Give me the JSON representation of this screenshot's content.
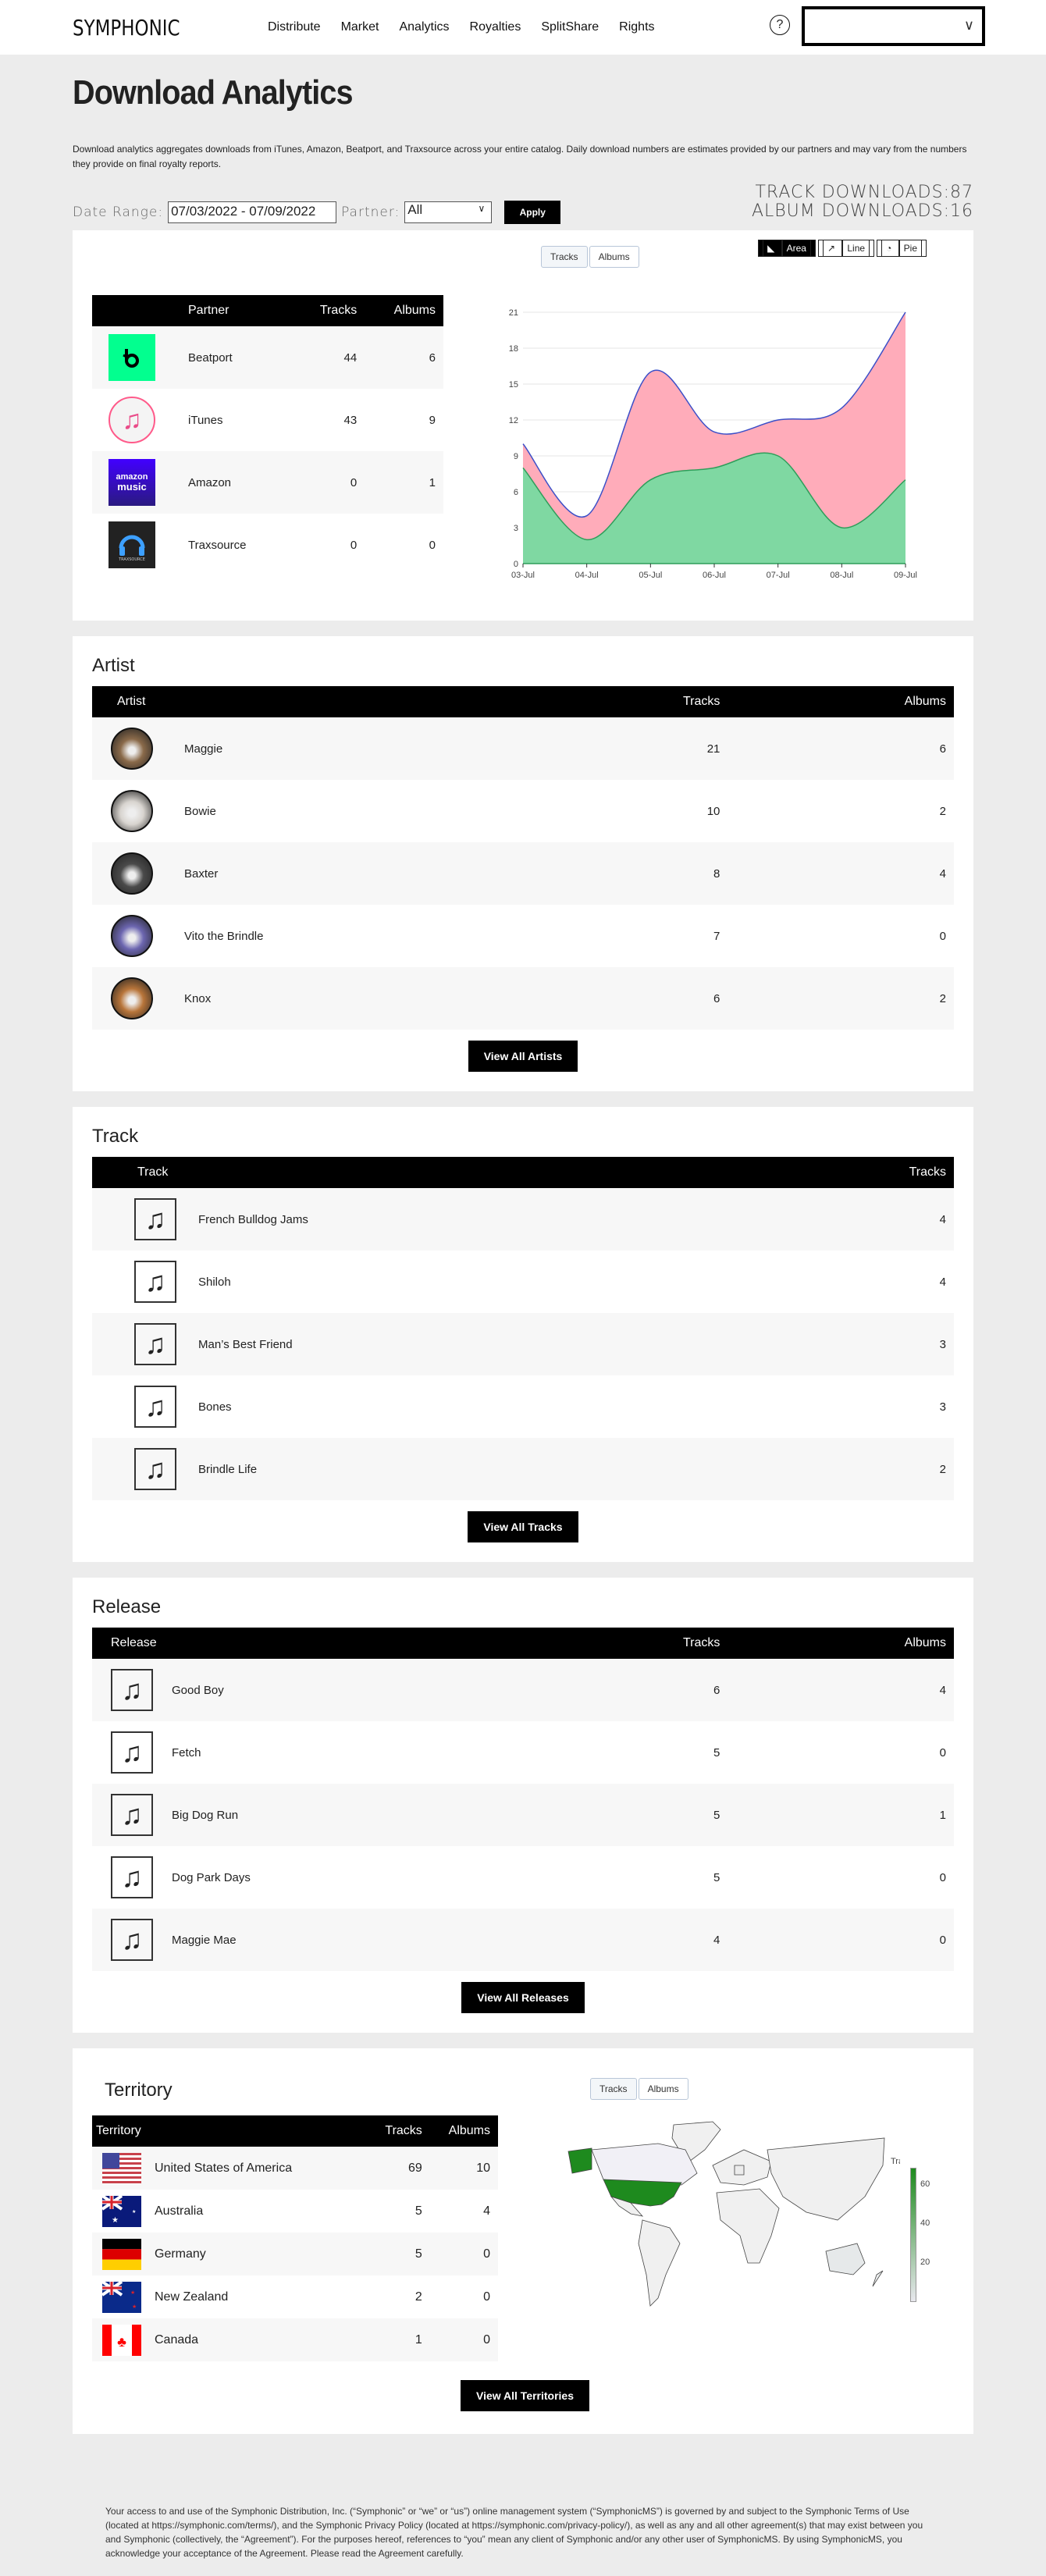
{
  "header": {
    "logo": "SYMPHONIC",
    "nav": [
      "Distribute",
      "Market",
      "Analytics",
      "Royalties",
      "SplitShare",
      "Rights"
    ],
    "help_icon": "?",
    "account_select_value": "",
    "chevron": "∨"
  },
  "page": {
    "title": "Download Analytics",
    "intro": "Download analytics aggregates downloads from iTunes, Amazon, Beatport, and Traxsource across your entire catalog. Daily download numbers are estimates provided by our partners and may vary from the numbers they provide on final royalty reports.",
    "date_range_label": "Date Range:",
    "date_range_value": "07/03/2022 - 07/09/2022",
    "partner_label": "Partner:",
    "partner_value": "All",
    "apply_label": "Apply",
    "track_downloads": "TRACK DOWNLOADS:87",
    "album_downloads": "ALBUM DOWNLOADS:16"
  },
  "partners": {
    "headers": [
      "",
      "Partner",
      "Tracks",
      "Albums"
    ],
    "rows": [
      {
        "name": "Beatport",
        "tracks": "44",
        "albums": "6",
        "icon": "beatport-logo"
      },
      {
        "name": "iTunes",
        "tracks": "43",
        "albums": "9",
        "icon": "itunes-logo"
      },
      {
        "name": "Amazon",
        "tracks": "0",
        "albums": "1",
        "icon": "amazon-music-logo"
      },
      {
        "name": "Traxsource",
        "tracks": "0",
        "albums": "0",
        "icon": "traxsource-logo"
      }
    ]
  },
  "chart_toggle": {
    "tracks": "Tracks",
    "albums": "Albums",
    "selected": "Tracks"
  },
  "chart_type": {
    "area": "Area",
    "line": "Line",
    "pie": "Pie",
    "selected": "Area"
  },
  "chart_data": {
    "type": "area",
    "stacked": true,
    "title": "",
    "xlabel": "",
    "ylabel": "",
    "categories": [
      "03-Jul",
      "04-Jul",
      "05-Jul",
      "06-Jul",
      "07-Jul",
      "08-Jul",
      "09-Jul"
    ],
    "series": [
      {
        "name": "Beatport",
        "color": "#7fd8a2",
        "line": "#2e9e5a",
        "values": [
          8,
          2,
          7,
          8,
          9,
          3,
          7
        ]
      },
      {
        "name": "iTunes",
        "color": "#ffacba",
        "line": "#3b4fc8",
        "values": [
          2,
          2,
          9,
          3,
          3,
          10,
          14
        ]
      }
    ],
    "yticks": [
      0,
      3,
      6,
      9,
      12,
      15,
      18,
      21
    ],
    "ylim": [
      0,
      21
    ],
    "grid": true
  },
  "artists": {
    "title": "Artist",
    "headers": [
      "Artist",
      "Tracks",
      "Albums"
    ],
    "rows": [
      {
        "name": "Maggie",
        "tracks": "21",
        "albums": "6",
        "color": "#8a6a4a"
      },
      {
        "name": "Bowie",
        "tracks": "10",
        "albums": "2",
        "color": "#d8d4cf"
      },
      {
        "name": "Baxter",
        "tracks": "8",
        "albums": "4",
        "color": "#4a4a4a"
      },
      {
        "name": "Vito the Brindle",
        "tracks": "7",
        "albums": "0",
        "color": "#6c66b0"
      },
      {
        "name": "Knox",
        "tracks": "6",
        "albums": "2",
        "color": "#b8753a"
      }
    ],
    "button": "View All Artists"
  },
  "tracks": {
    "title": "Track",
    "headers": [
      "Track",
      "Tracks"
    ],
    "rows": [
      {
        "name": "French Bulldog Jams",
        "tracks": "4"
      },
      {
        "name": "Shiloh",
        "tracks": "4"
      },
      {
        "name": "Man’s Best Friend",
        "tracks": "3"
      },
      {
        "name": "Bones",
        "tracks": "3"
      },
      {
        "name": "Brindle Life",
        "tracks": "2"
      }
    ],
    "button": "View All Tracks"
  },
  "releases": {
    "title": "Release",
    "headers": [
      "Release",
      "Tracks",
      "Albums"
    ],
    "rows": [
      {
        "name": "Good Boy",
        "tracks": "6",
        "albums": "4"
      },
      {
        "name": "Fetch",
        "tracks": "5",
        "albums": "0"
      },
      {
        "name": "Big Dog Run",
        "tracks": "5",
        "albums": "1"
      },
      {
        "name": "Dog Park Days",
        "tracks": "5",
        "albums": "0"
      },
      {
        "name": "Maggie Mae",
        "tracks": "4",
        "albums": "0"
      }
    ],
    "button": "View All Releases"
  },
  "territories": {
    "title": "Territory",
    "headers": [
      "Territory",
      "Tracks",
      "Albums"
    ],
    "rows": [
      {
        "name": "United States of America",
        "tracks": "69",
        "albums": "10",
        "flag": "us"
      },
      {
        "name": "Australia",
        "tracks": "5",
        "albums": "4",
        "flag": "au"
      },
      {
        "name": "Germany",
        "tracks": "5",
        "albums": "0",
        "flag": "de"
      },
      {
        "name": "New Zealand",
        "tracks": "2",
        "albums": "0",
        "flag": "nz"
      },
      {
        "name": "Canada",
        "tracks": "1",
        "albums": "0",
        "flag": "ca"
      }
    ],
    "map_toggle": {
      "tracks": "Tracks",
      "albums": "Albums"
    },
    "colorbar_title": "Tracks",
    "colorbar_ticks": [
      "60",
      "40",
      "20"
    ],
    "button": "View All Territories"
  },
  "footer": {
    "text": "Your access to and use of the Symphonic Distribution, Inc. (“Symphonic” or “we” or “us”) online management system (“SymphonicMS”) is governed by and subject to the Symphonic Terms of Use (located at https://symphonic.com/terms/), and the Symphonic Privacy Policy (located at https://symphonic.com/privacy-policy/), as well as any and all other agreement(s) that may exist between you and Symphonic (collectively, the “Agreement”). For the purposes hereof, references to “you” mean any client of Symphonic and/or any other user of SymphonicMS. By using SymphonicMS, you acknowledge your acceptance of the Agreement. Please read the Agreement carefully."
  }
}
